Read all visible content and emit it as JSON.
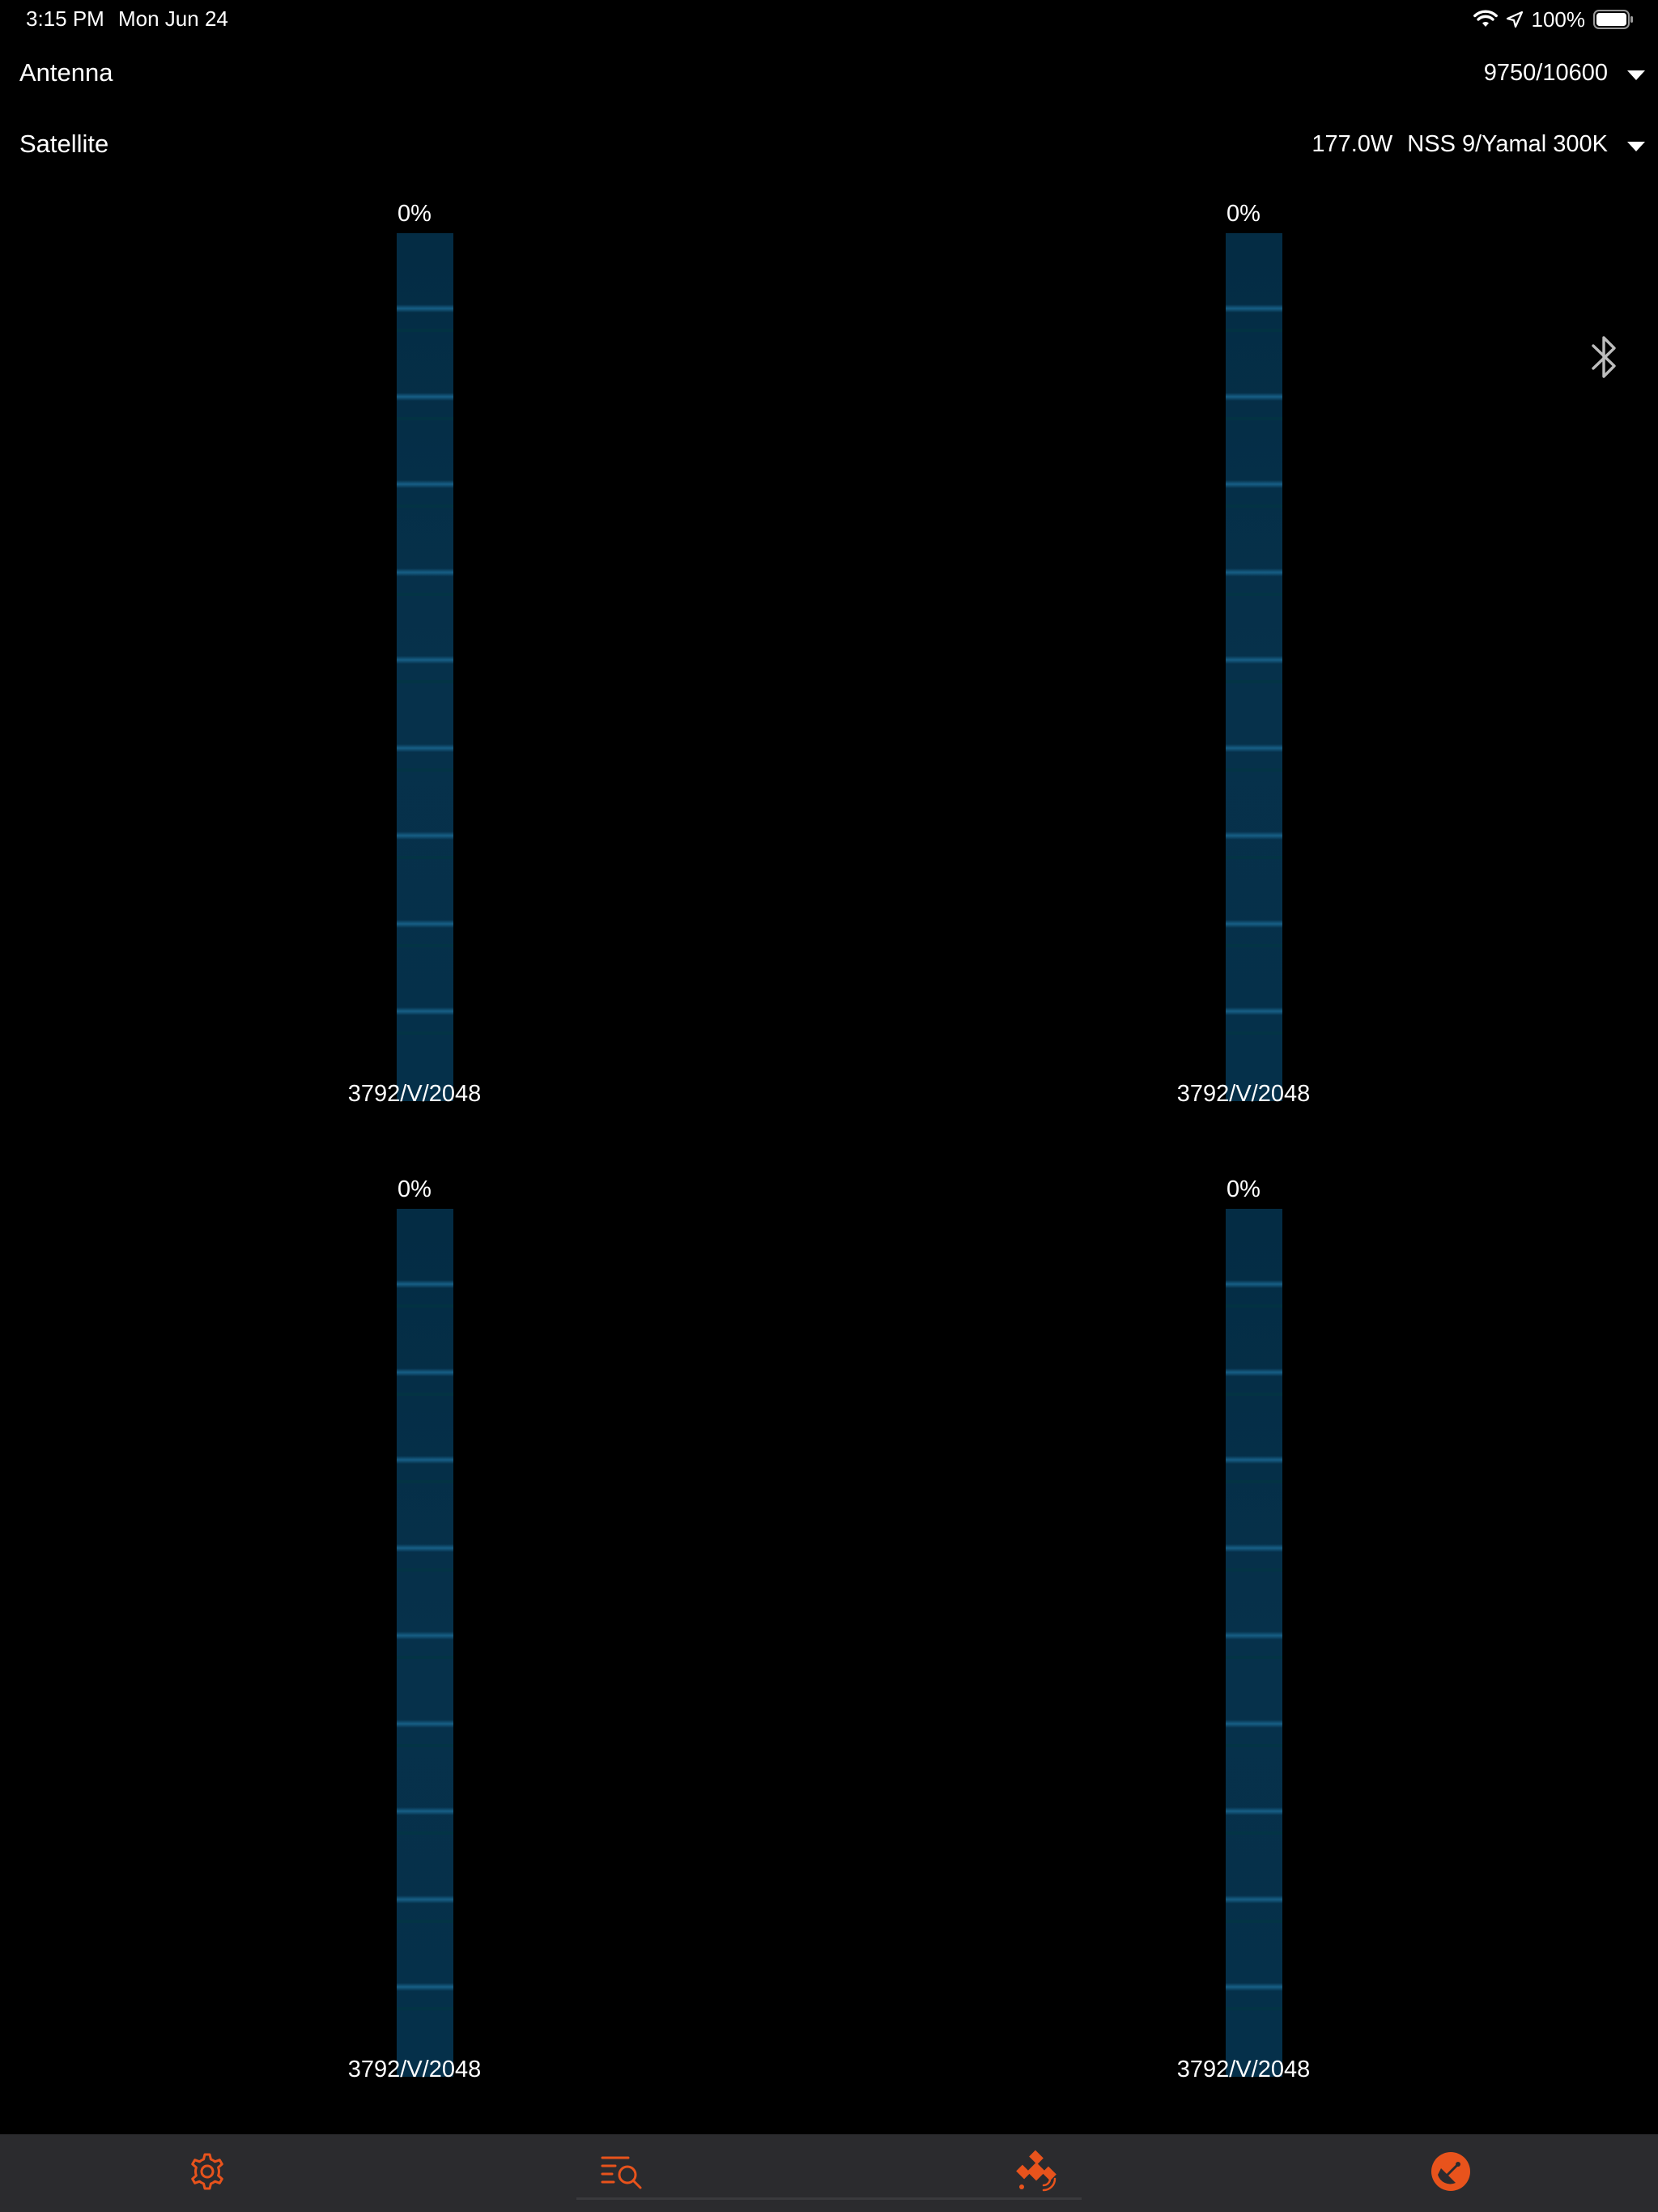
{
  "status_bar": {
    "time": "3:15 PM",
    "date": "Mon Jun 24",
    "battery_percent": "100%"
  },
  "settings": {
    "antenna": {
      "label": "Antenna",
      "value": "9750/10600"
    },
    "satellite": {
      "label": "Satellite",
      "position": "177.0W",
      "name": "NSS 9/Yamal 300K"
    }
  },
  "meters": [
    {
      "percent": "0%",
      "level": 0,
      "transponder": "3792/V/2048"
    },
    {
      "percent": "0%",
      "level": 0,
      "transponder": "3792/V/2048"
    },
    {
      "percent": "0%",
      "level": 0,
      "transponder": "3792/V/2048"
    },
    {
      "percent": "0%",
      "level": 0,
      "transponder": "3792/V/2048"
    }
  ],
  "tabs": [
    {
      "icon": "gear-icon"
    },
    {
      "icon": "list-search-icon"
    },
    {
      "icon": "satellite-icon"
    },
    {
      "icon": "dish-icon"
    }
  ],
  "colors": {
    "background": "#000000",
    "accent": "#e8531c",
    "meter_fill": "#05304a",
    "tab_bar": "#2b2b2e"
  }
}
